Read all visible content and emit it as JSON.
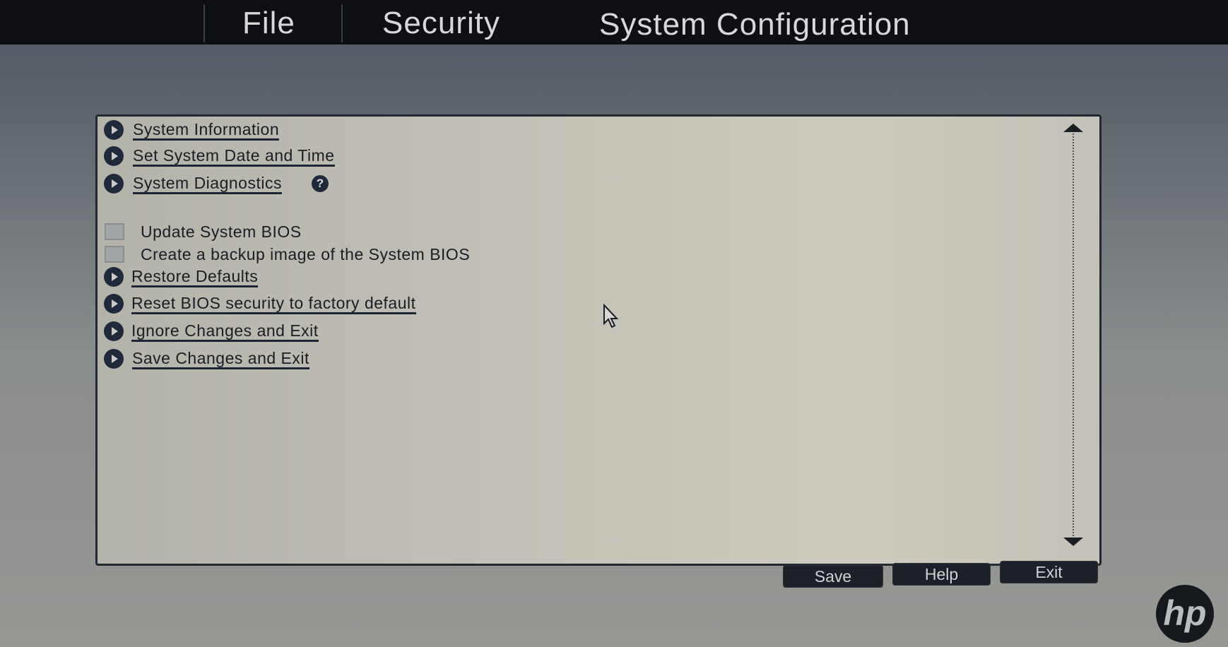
{
  "menu": {
    "tabs": [
      {
        "label": "File",
        "active": true
      },
      {
        "label": "Security"
      },
      {
        "label": "System Configuration"
      }
    ]
  },
  "panel": {
    "items": [
      {
        "type": "link",
        "label": "System Information"
      },
      {
        "type": "link",
        "label": "Set System Date and Time"
      },
      {
        "type": "link",
        "label": "System Diagnostics",
        "help_icon": "?"
      },
      {
        "type": "disabled",
        "label": "Update System BIOS"
      },
      {
        "type": "disabled",
        "label": "Create a backup image of the System BIOS"
      },
      {
        "type": "link",
        "label": "Restore Defaults"
      },
      {
        "type": "link",
        "label": "Reset BIOS security to factory default"
      },
      {
        "type": "link",
        "label": "Ignore Changes and Exit"
      },
      {
        "type": "link",
        "label": "Save Changes and Exit"
      }
    ]
  },
  "buttons": {
    "save": "Save",
    "help": "Help",
    "exit": "Exit"
  },
  "logo": "hp"
}
